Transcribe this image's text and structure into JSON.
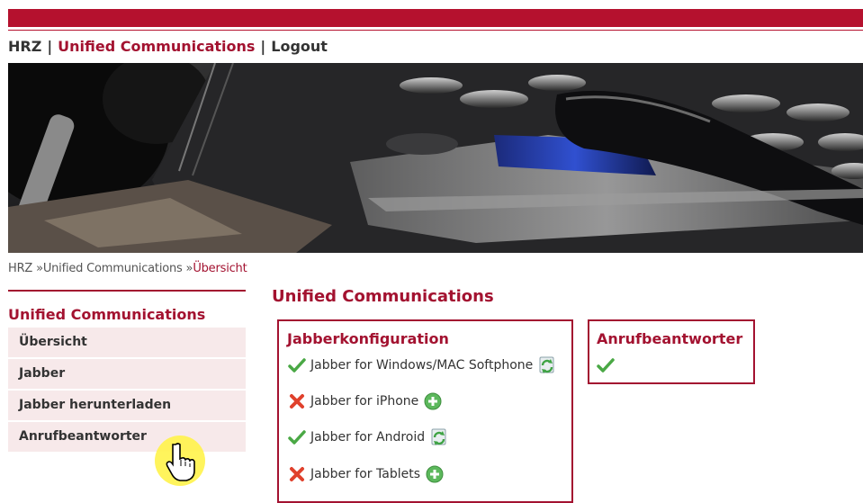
{
  "topnav": {
    "hrz": "HRZ",
    "separator": "|",
    "unified": "Unified Communications",
    "logout": "Logout"
  },
  "breadcrumb": {
    "hrz": "HRZ",
    "sep": "»",
    "unified": "Unified Communications",
    "current": "Übersicht"
  },
  "sidebar": {
    "title": "Unified Communications",
    "items": [
      {
        "label": "Übersicht"
      },
      {
        "label": "Jabber"
      },
      {
        "label": "Jabber herunterladen"
      },
      {
        "label": "Anrufbeantworter"
      }
    ]
  },
  "main": {
    "title": "Unified Communications",
    "jabber": {
      "title": "Jabberkonfiguration",
      "items": [
        {
          "label": "Jabber for Windows/MAC Softphone",
          "status": "check-icon",
          "action": "refresh-icon"
        },
        {
          "label": "Jabber for iPhone",
          "status": "cross-icon",
          "action": "add-icon"
        },
        {
          "label": "Jabber for Android",
          "status": "check-icon",
          "action": "refresh-icon"
        },
        {
          "label": "Jabber for Tablets",
          "status": "cross-icon",
          "action": "add-icon"
        }
      ]
    },
    "voicemail": {
      "title": "Anrufbeantworter",
      "status": "check-icon"
    }
  },
  "colors": {
    "brand": "#b5112e",
    "link_accent": "#a31230",
    "menu_bg": "#f7e9ea",
    "check": "#4aa845",
    "cross": "#e0412c"
  }
}
